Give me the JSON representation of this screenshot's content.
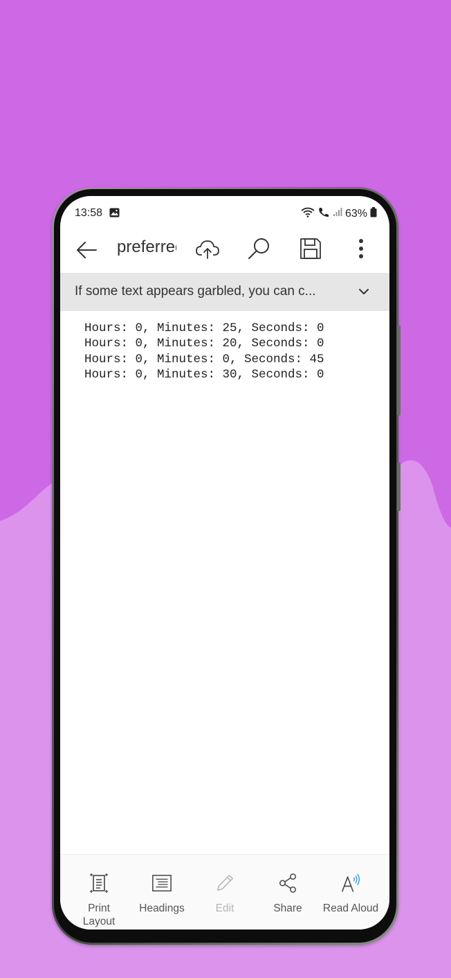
{
  "colors": {
    "background_top": "#cd69e5",
    "background_bottom": "#db93ec",
    "banner_bg": "#e6e6e6",
    "text": "#333333",
    "read_aloud_accent": "#3a9bd9"
  },
  "status_bar": {
    "time": "13:58",
    "battery": "63%",
    "icons": [
      "image-icon",
      "wifi-call-icon",
      "call-icon",
      "signal-icon",
      "battery-icon"
    ]
  },
  "app_bar": {
    "title": "preferred",
    "icons": [
      "back-arrow-icon",
      "cloud-upload-icon",
      "search-icon",
      "save-icon",
      "more-vertical-icon"
    ]
  },
  "banner": {
    "text": "If some text appears garbled, you can c..."
  },
  "document": {
    "lines": [
      "Hours: 0, Minutes: 25, Seconds: 0",
      "Hours: 0, Minutes: 20, Seconds: 0",
      "Hours: 0, Minutes: 0, Seconds: 45",
      "Hours: 0, Minutes: 30, Seconds: 0"
    ]
  },
  "toolbar": {
    "items": [
      {
        "label": "Print\nLayout",
        "icon": "print-layout-icon",
        "enabled": true
      },
      {
        "label": "Headings",
        "icon": "headings-icon",
        "enabled": true
      },
      {
        "label": "Edit",
        "icon": "pencil-icon",
        "enabled": false
      },
      {
        "label": "Share",
        "icon": "share-icon",
        "enabled": true
      },
      {
        "label": "Read Aloud",
        "icon": "read-aloud-icon",
        "enabled": true
      }
    ]
  }
}
